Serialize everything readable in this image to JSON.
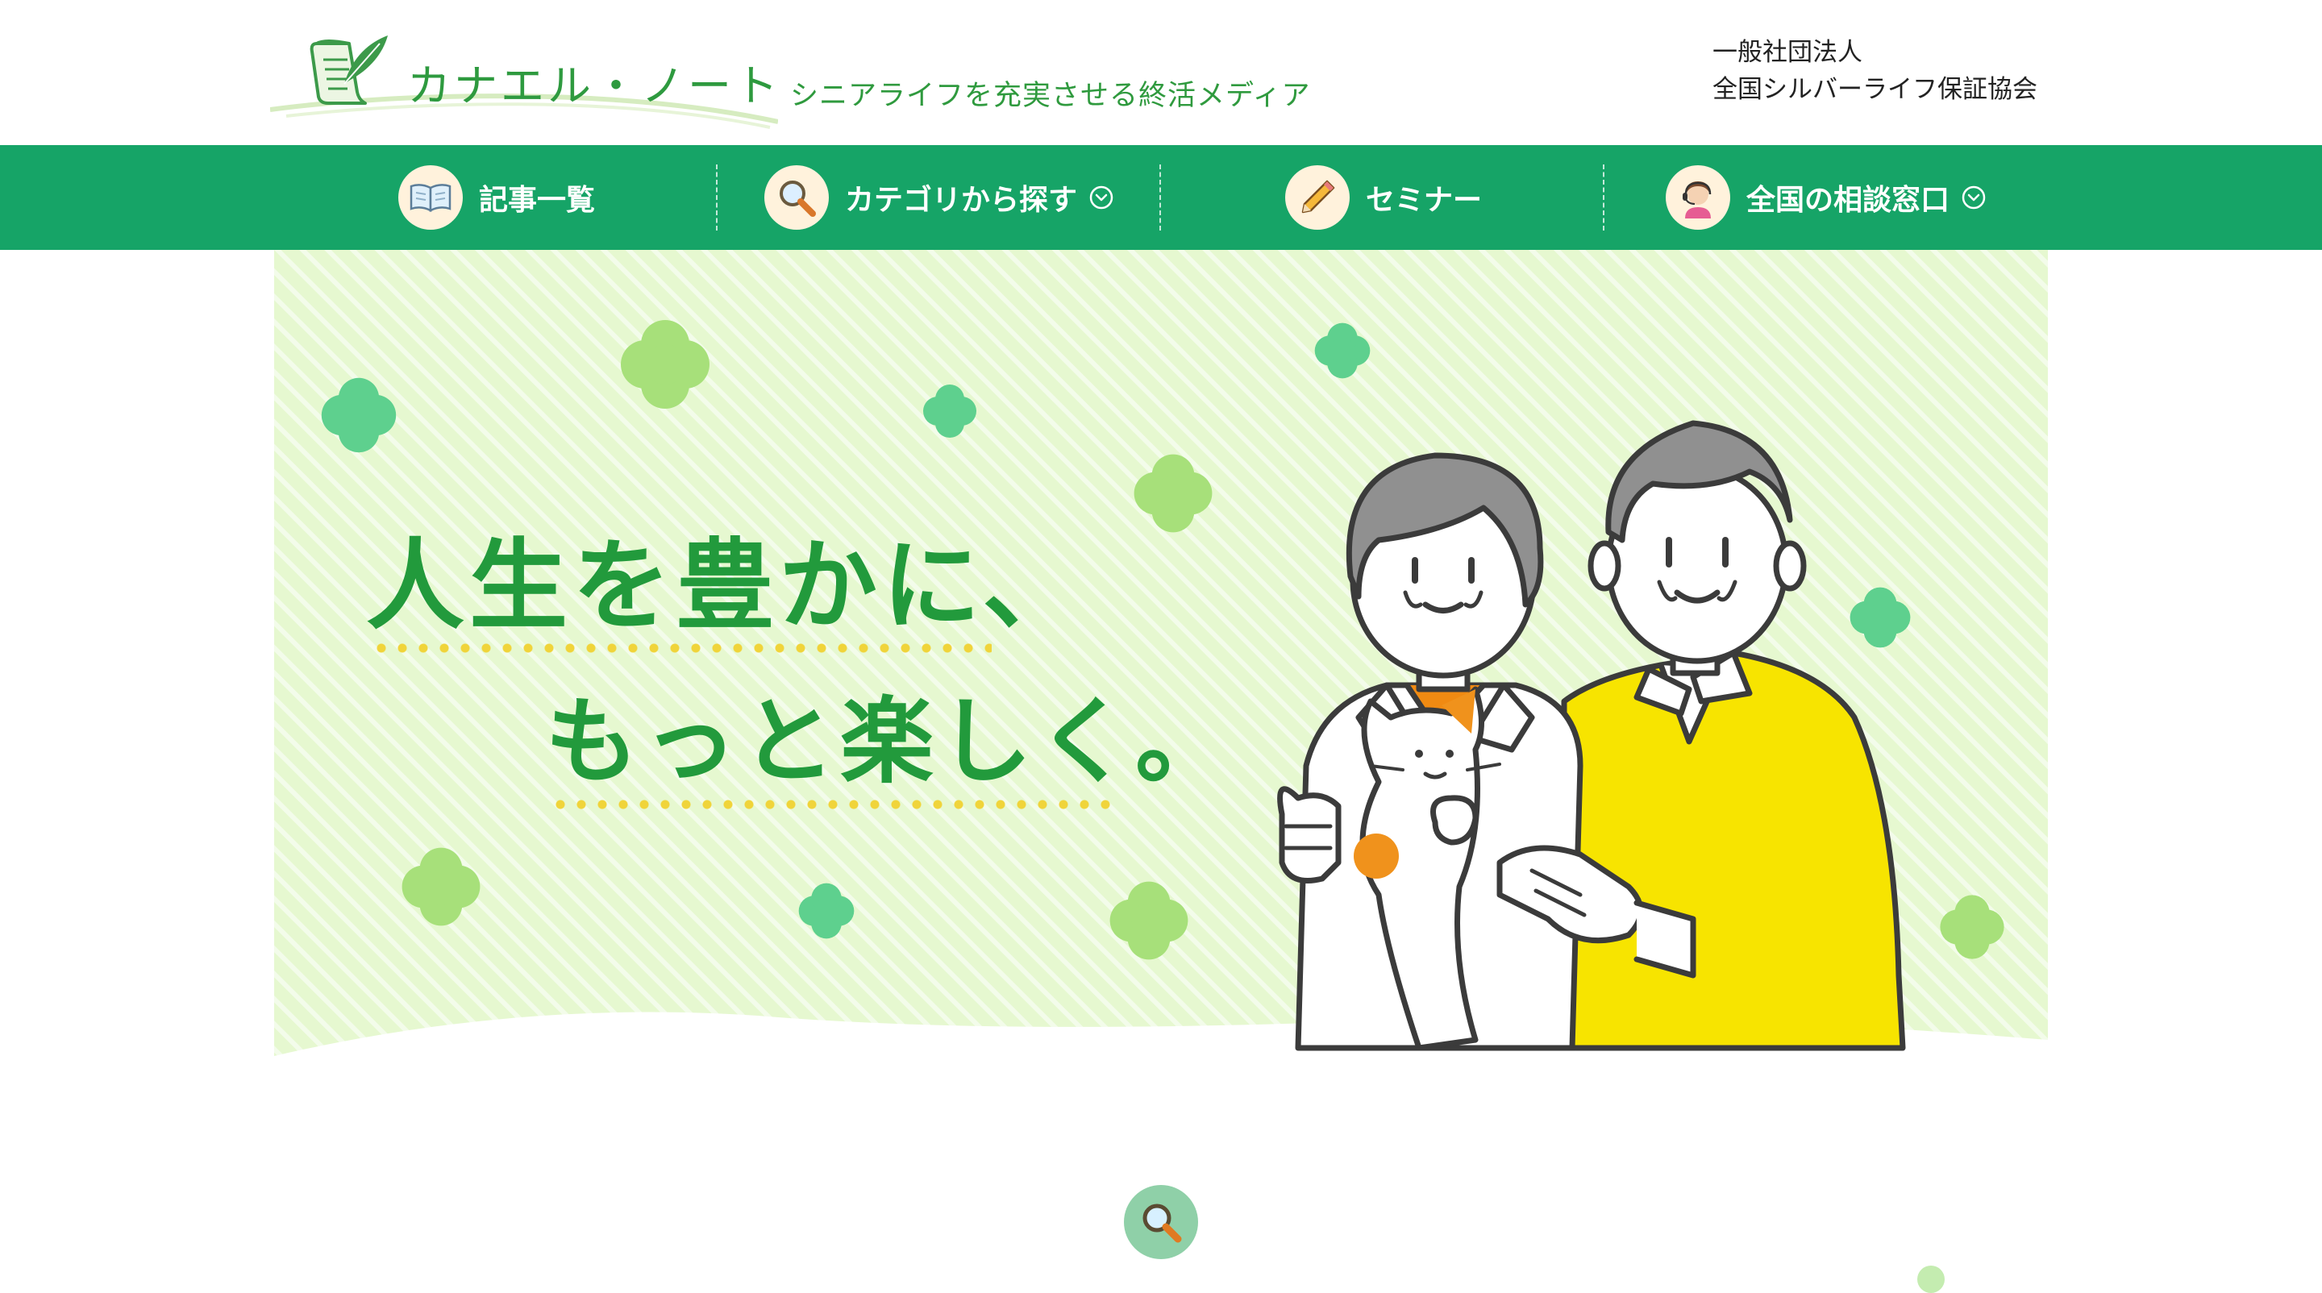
{
  "header": {
    "logo_text": "カナエル・ノート",
    "tagline": "シニアライフを充実させる終活メディア",
    "org_line1": "一般社団法人",
    "org_line2": "全国シルバーライフ保証協会"
  },
  "nav": {
    "items": [
      {
        "label": "記事一覧",
        "icon": "book-icon",
        "dropdown": false
      },
      {
        "label": "カテゴリから探す",
        "icon": "magnifier-icon",
        "dropdown": true
      },
      {
        "label": "セミナー",
        "icon": "pencil-icon",
        "dropdown": false
      },
      {
        "label": "全国の相談窓口",
        "icon": "operator-icon",
        "dropdown": true
      }
    ]
  },
  "hero": {
    "copy_line1": "人生を豊かに、",
    "copy_line2": "もっと楽しく。",
    "illustration": "senior-couple-with-cat"
  },
  "search": {
    "icon": "search-icon"
  },
  "colors": {
    "brand_green": "#16a467",
    "logo_green": "#2e9a3f",
    "hero_bg": "#e6f8d0",
    "accent_yellow": "#f7e400",
    "dot_yellow": "#f0d43a"
  }
}
